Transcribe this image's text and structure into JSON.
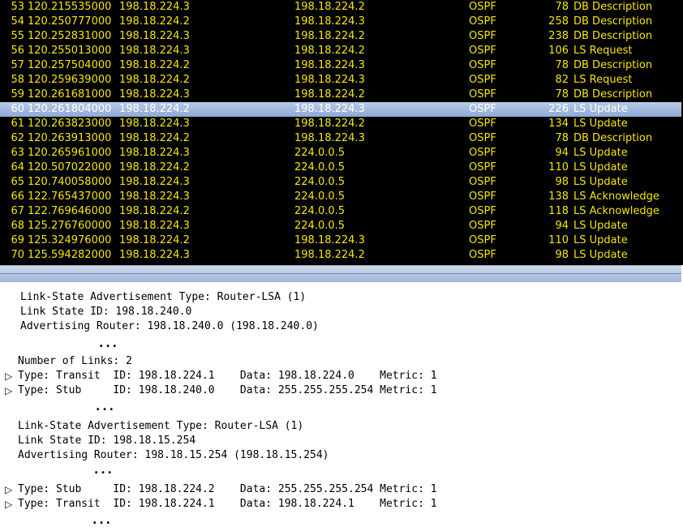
{
  "packets": [
    {
      "no": "53",
      "time": "120.215535000",
      "src": "198.18.224.3",
      "dst": "198.18.224.2",
      "proto": "OSPF",
      "len": "78",
      "info": "DB Description"
    },
    {
      "no": "54",
      "time": "120.250777000",
      "src": "198.18.224.2",
      "dst": "198.18.224.3",
      "proto": "OSPF",
      "len": "258",
      "info": "DB Description"
    },
    {
      "no": "55",
      "time": "120.252831000",
      "src": "198.18.224.3",
      "dst": "198.18.224.2",
      "proto": "OSPF",
      "len": "238",
      "info": "DB Description"
    },
    {
      "no": "56",
      "time": "120.255013000",
      "src": "198.18.224.3",
      "dst": "198.18.224.2",
      "proto": "OSPF",
      "len": "106",
      "info": "LS Request"
    },
    {
      "no": "57",
      "time": "120.257504000",
      "src": "198.18.224.2",
      "dst": "198.18.224.3",
      "proto": "OSPF",
      "len": "78",
      "info": "DB Description"
    },
    {
      "no": "58",
      "time": "120.259639000",
      "src": "198.18.224.2",
      "dst": "198.18.224.3",
      "proto": "OSPF",
      "len": "82",
      "info": "LS Request"
    },
    {
      "no": "59",
      "time": "120.261681000",
      "src": "198.18.224.3",
      "dst": "198.18.224.2",
      "proto": "OSPF",
      "len": "78",
      "info": "DB Description"
    },
    {
      "no": "60",
      "time": "120.261804000",
      "src": "198.18.224.2",
      "dst": "198.18.224.3",
      "proto": "OSPF",
      "len": "226",
      "info": "LS Update",
      "selected": true
    },
    {
      "no": "61",
      "time": "120.263823000",
      "src": "198.18.224.3",
      "dst": "198.18.224.2",
      "proto": "OSPF",
      "len": "134",
      "info": "LS Update"
    },
    {
      "no": "62",
      "time": "120.263913000",
      "src": "198.18.224.2",
      "dst": "198.18.224.3",
      "proto": "OSPF",
      "len": "78",
      "info": "DB Description"
    },
    {
      "no": "63",
      "time": "120.265961000",
      "src": "198.18.224.3",
      "dst": "224.0.0.5",
      "proto": "OSPF",
      "len": "94",
      "info": "LS Update"
    },
    {
      "no": "64",
      "time": "120.507022000",
      "src": "198.18.224.2",
      "dst": "224.0.0.5",
      "proto": "OSPF",
      "len": "110",
      "info": "LS Update"
    },
    {
      "no": "65",
      "time": "120.740058000",
      "src": "198.18.224.3",
      "dst": "224.0.0.5",
      "proto": "OSPF",
      "len": "98",
      "info": "LS Update"
    },
    {
      "no": "66",
      "time": "122.765437000",
      "src": "198.18.224.3",
      "dst": "224.0.0.5",
      "proto": "OSPF",
      "len": "138",
      "info": "LS Acknowledge"
    },
    {
      "no": "67",
      "time": "122.769646000",
      "src": "198.18.224.2",
      "dst": "224.0.0.5",
      "proto": "OSPF",
      "len": "118",
      "info": "LS Acknowledge"
    },
    {
      "no": "68",
      "time": "125.276760000",
      "src": "198.18.224.3",
      "dst": "224.0.0.5",
      "proto": "OSPF",
      "len": "94",
      "info": "LS Update"
    },
    {
      "no": "69",
      "time": "125.324976000",
      "src": "198.18.224.2",
      "dst": "198.18.224.3",
      "proto": "OSPF",
      "len": "110",
      "info": "LS Update"
    },
    {
      "no": "70",
      "time": "125.594282000",
      "src": "198.18.224.3",
      "dst": "198.18.224.2",
      "proto": "OSPF",
      "len": "98",
      "info": "LS Update"
    }
  ],
  "details": {
    "lsa1": {
      "type": "Link-State Advertisement Type: Router-LSA (1)",
      "link_state_id": "Link State ID: 198.18.240.0",
      "adv_router": "Advertising Router: 198.18.240.0 (198.18.240.0)"
    },
    "ellipsis": "...",
    "num_links": "Number of Links: 2",
    "links1": [
      "Type: Transit  ID: 198.18.224.1    Data: 198.18.224.0    Metric: 1",
      "Type: Stub     ID: 198.18.240.0    Data: 255.255.255.254 Metric: 1"
    ],
    "lsa2": {
      "type": "Link-State Advertisement Type: Router-LSA (1)",
      "link_state_id": "Link State ID: 198.18.15.254",
      "adv_router": "Advertising Router: 198.18.15.254 (198.18.15.254)"
    },
    "links2": [
      "Type: Stub     ID: 198.18.224.2    Data: 255.255.255.254 Metric: 1",
      "Type: Transit  ID: 198.18.224.1    Data: 198.18.224.1    Metric: 1"
    ]
  },
  "colors": {
    "list_bg": "#000000",
    "list_text": "#f5e600",
    "selected_bg": "#9fb6dc"
  }
}
